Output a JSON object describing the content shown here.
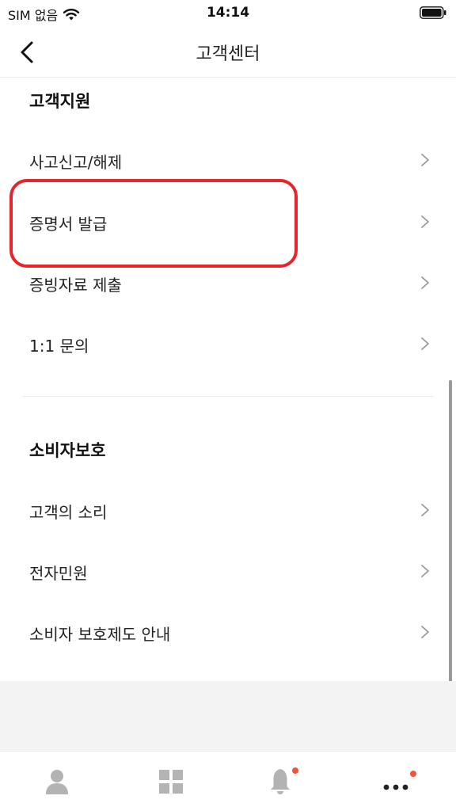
{
  "status_bar": {
    "carrier": "SIM 없음",
    "time": "14:14"
  },
  "nav": {
    "title": "고객센터"
  },
  "sections": [
    {
      "title": "고객지원",
      "items": [
        "사고신고/해제",
        "증명서 발급",
        "증빙자료 제출",
        "1:1 문의"
      ]
    },
    {
      "title": "소비자보호",
      "items": [
        "고객의 소리",
        "전자민원",
        "소비자 보호제도 안내"
      ]
    }
  ],
  "tabs": [
    {
      "icon": "person-icon"
    },
    {
      "icon": "grid-icon"
    },
    {
      "icon": "bell-icon",
      "badge_color": "#f0553a"
    },
    {
      "icon": "more-icon",
      "badge_color": "#f0553a"
    }
  ],
  "colors": {
    "highlight": "#e6242a",
    "badge": "#f0553a",
    "tab_icon": "#b3b3b3"
  }
}
